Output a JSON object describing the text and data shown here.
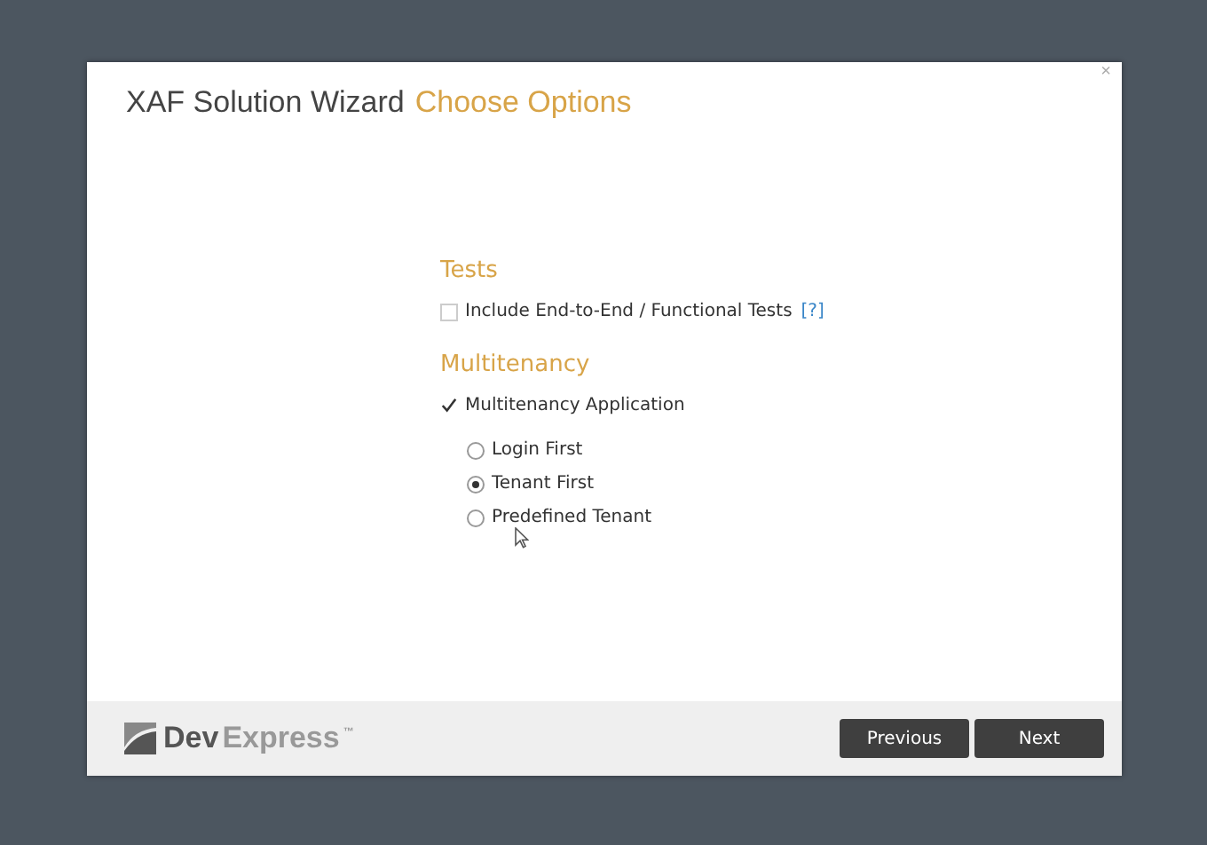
{
  "window": {
    "title": "XAF Solution Wizard",
    "subtitle": "Choose Options",
    "close": "×"
  },
  "sections": [
    {
      "heading": "Tests",
      "items": [
        {
          "kind": "checkbox",
          "label": "Include End-to-End / Functional Tests",
          "help": "[?]",
          "checked": false
        }
      ]
    },
    {
      "heading": "Multitenancy",
      "items": [
        {
          "kind": "checkbox",
          "label": "Multitenancy Application",
          "checked": true
        },
        {
          "kind": "radio",
          "label": "Login First",
          "selected": false
        },
        {
          "kind": "radio",
          "label": "Tenant First",
          "selected": true
        },
        {
          "kind": "radio",
          "label": "Predefined Tenant",
          "selected": false
        }
      ]
    }
  ],
  "footer": {
    "logo": {
      "primary": "Dev",
      "secondary": "Express",
      "trademark": "™"
    },
    "buttons": [
      "Previous",
      "Next"
    ]
  }
}
